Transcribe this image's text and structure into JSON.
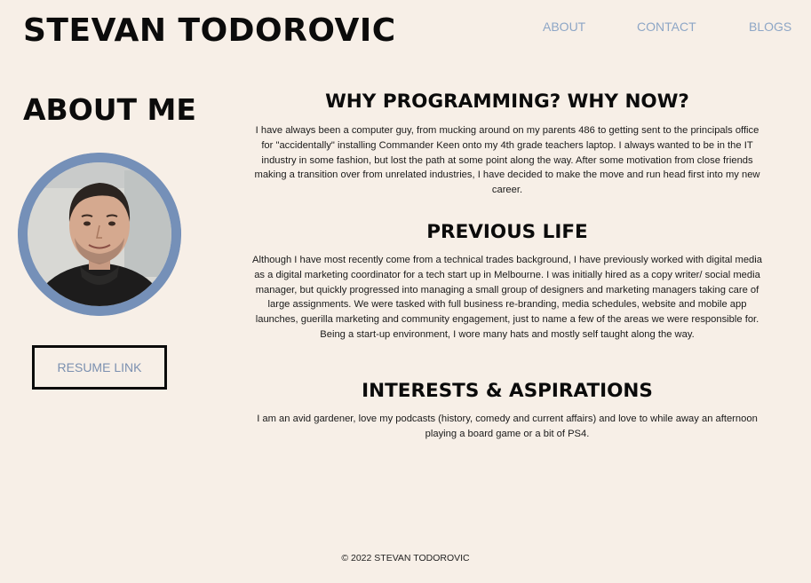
{
  "header": {
    "site_title": "STEVAN TODOROVIC",
    "nav": {
      "about": "ABOUT",
      "contact": "CONTACT",
      "blogs": "BLOGS"
    }
  },
  "sidebar": {
    "heading": "ABOUT ME",
    "resume_button": "RESUME LINK",
    "avatar_border_color": "#7590b8"
  },
  "sections": {
    "why_programming": {
      "title": "WHY PROGRAMMING? WHY NOW?",
      "text": "I have always been a computer guy, from mucking around on my parents 486 to getting sent to the principals office for \"accidentally\" installing Commander Keen onto my 4th grade teachers laptop. I always wanted to be in the IT industry in some fashion, but lost the path at some point along the way. After some motivation from close friends making a transition over from unrelated industries, I have decided to make the move and run head first into my new career."
    },
    "previous_life": {
      "title": "PREVIOUS LIFE",
      "text": "Although I have most recently come from a technical trades background, I have previously worked with digital media as a digital marketing coordinator for a tech start up in Melbourne. I was initially hired as a copy writer/ social media manager, but quickly progressed into managing a small group of designers and marketing managers taking care of large assignments. We were tasked with full business re-branding, media schedules, website and mobile app launches, guerilla marketing and community engagement, just to name a few of the areas we were responsible for. Being a start-up environment, I wore many hats and mostly self taught along the way."
    },
    "interests": {
      "title": "INTERESTS & ASPIRATIONS",
      "text": "I am an avid gardener, love my podcasts (history, comedy and current affairs) and love to while away an afternoon playing a board game or a bit of PS4."
    }
  },
  "footer": {
    "copyright": "© 2022 STEVAN TODOROVIC"
  },
  "colors": {
    "background": "#f7efe7",
    "nav_link": "#8da6c6",
    "accent": "#7590b8"
  }
}
